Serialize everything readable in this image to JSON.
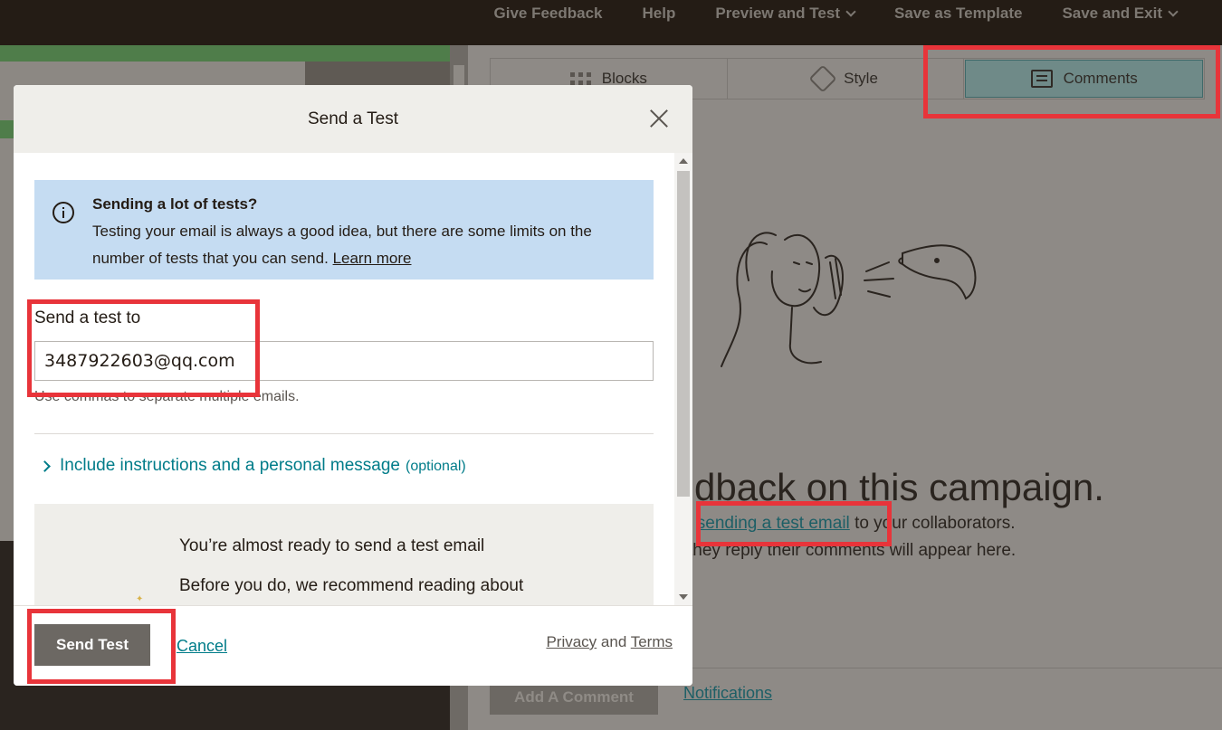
{
  "topnav": {
    "items": [
      {
        "label": "Give Feedback",
        "has_chevron": false
      },
      {
        "label": "Help",
        "has_chevron": false
      },
      {
        "label": "Preview and Test",
        "has_chevron": true
      },
      {
        "label": "Save as Template",
        "has_chevron": false
      },
      {
        "label": "Save and Exit",
        "has_chevron": true
      }
    ]
  },
  "right_panel": {
    "tabs": [
      {
        "label": "Blocks",
        "icon": "grid-icon"
      },
      {
        "label": "Style",
        "icon": "style-icon"
      },
      {
        "label": "Comments",
        "icon": "comment-icon",
        "active": true
      }
    ],
    "headline": "dback on this campaign.",
    "sub1_prefix": "y",
    "sub1_link": "sending a test email",
    "sub1_suffix": "to your collaborators.",
    "sub2": "they reply their comments will appear here.",
    "add_comment_label": "Add A Comment",
    "notifications_label": "Notifications"
  },
  "modal": {
    "title": "Send a Test",
    "info_title": "Sending a lot of tests?",
    "info_text": "Testing your email is always a good idea, but there are some limits on the number of tests that you can send.",
    "info_link": "Learn more",
    "field_label": "Send a test to",
    "email_value": "3487922603@qq.com",
    "helper_text": "Use commas to separate multiple emails.",
    "expand_label": "Include instructions and a personal message",
    "expand_optional": "(optional)",
    "ready_title": "You’re almost ready to send a test email",
    "ready_text": "Before you do, we recommend reading about",
    "send_button": "Send Test",
    "cancel_link": "Cancel",
    "legal_privacy": "Privacy",
    "legal_and": "and",
    "legal_terms": "Terms"
  },
  "colors": {
    "accent_teal": "#007c89",
    "highlight_red": "#e8343a",
    "info_bg": "#c5dcf2"
  }
}
